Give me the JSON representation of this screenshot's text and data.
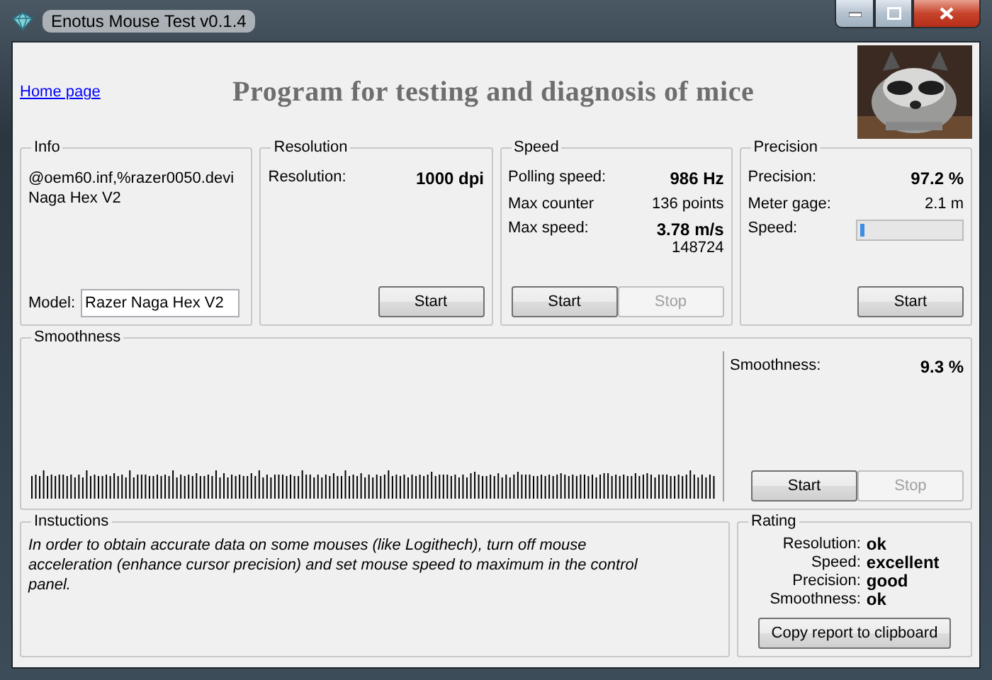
{
  "window": {
    "title": "Enotus Mouse Test v0.1.4"
  },
  "header": {
    "link": "Home page",
    "heading": "Program for testing and diagnosis of mice",
    "kind": "picture"
  },
  "info": {
    "title": "Info",
    "lines": [
      "@oem60.inf,%razer0050.devi",
      "Naga Hex V2"
    ],
    "model_label": "Model:",
    "model_value": "Razer Naga Hex V2"
  },
  "panels": [
    {
      "title": "Resolution",
      "rows": [
        {
          "kind": "stat",
          "label": "Resolution:",
          "value": "1000 dpi",
          "bold": true
        }
      ],
      "buttons": [
        {
          "label": "Start",
          "disabled": false
        }
      ]
    },
    {
      "title": "Speed",
      "rows": [
        {
          "kind": "stat",
          "label": "Polling speed:",
          "value": "986 Hz",
          "bold": true
        },
        {
          "kind": "stat",
          "label": "Max counter",
          "value": "136 points",
          "bold": false
        },
        {
          "kind": "stat",
          "label": "Max  speed:",
          "value": "3.78 m/s",
          "bold": true,
          "sub": "148724"
        }
      ],
      "buttons": [
        {
          "label": "Start",
          "disabled": false
        },
        {
          "label": "Stop",
          "disabled": true
        }
      ]
    },
    {
      "title": "Precision",
      "rows": [
        {
          "kind": "stat",
          "label": "Precision:",
          "value": "97.2 %",
          "bold": true
        },
        {
          "kind": "stat",
          "label": "Meter gage:",
          "value": "2.1 m",
          "bold": false
        },
        {
          "kind": "meter",
          "label": "Speed:",
          "level": 0.04
        }
      ],
      "buttons": [
        {
          "label": "Start",
          "disabled": false
        }
      ]
    }
  ],
  "smoothness": {
    "title": "Smoothness",
    "label": "Smoothness:",
    "value": "9.3 %",
    "buttons": [
      {
        "label": "Start",
        "disabled": false
      },
      {
        "label": "Stop",
        "disabled": true
      }
    ]
  },
  "instructions": {
    "title": "Instuctions",
    "text": "In order to obtain accurate data on some mouses (like Logithech), turn off mouse acceleration (enhance cursor precision) and set mouse speed to maximum in the control panel."
  },
  "rating": {
    "title": "Rating",
    "rows": [
      {
        "label": "Resolution:",
        "value": "ok"
      },
      {
        "label": "Speed:",
        "value": "excellent"
      },
      {
        "label": "Precision:",
        "value": "good"
      },
      {
        "label": "Smoothness:",
        "value": "ok"
      }
    ],
    "button": "Copy report to clipboard"
  }
}
